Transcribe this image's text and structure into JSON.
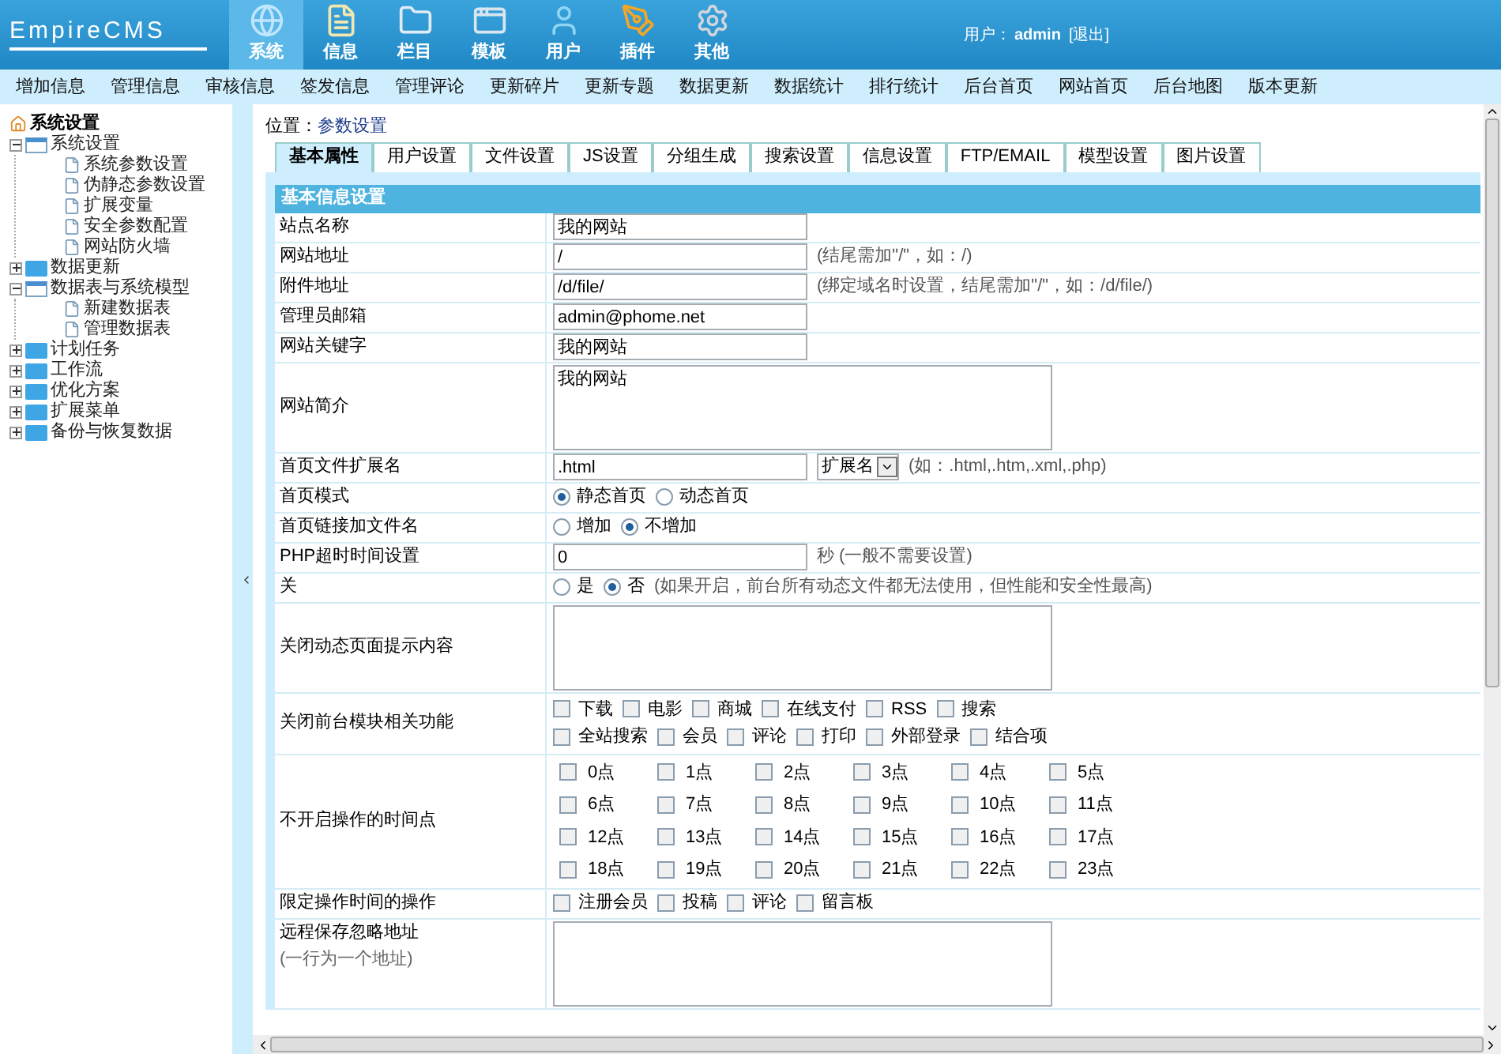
{
  "header": {
    "logo": "EmpireCMS",
    "nav": [
      {
        "label": "系统",
        "selected": true
      },
      {
        "label": "信息",
        "selected": false
      },
      {
        "label": "栏目",
        "selected": false
      },
      {
        "label": "模板",
        "selected": false
      },
      {
        "label": "用户",
        "selected": false
      },
      {
        "label": "插件",
        "selected": false
      },
      {
        "label": "其他",
        "selected": false
      }
    ],
    "user_label": "用户：",
    "user": "admin",
    "logout": "[退出]"
  },
  "menu": [
    "增加信息",
    "管理信息",
    "审核信息",
    "签发信息",
    "管理评论",
    "更新碎片",
    "更新专题",
    "数据更新",
    "数据统计",
    "排行统计",
    "后台首页",
    "网站首页",
    "后台地图",
    "版本更新"
  ],
  "tree": {
    "label": "系统设置",
    "children": [
      {
        "label": "系统设置",
        "expanded": true,
        "children": [
          {
            "label": "系统参数设置"
          },
          {
            "label": "伪静态参数设置"
          },
          {
            "label": "扩展变量"
          },
          {
            "label": "安全参数配置"
          },
          {
            "label": "网站防火墙"
          }
        ]
      },
      {
        "label": "数据更新",
        "expanded": false
      },
      {
        "label": "数据表与系统模型",
        "expanded": true,
        "children": [
          {
            "label": "新建数据表"
          },
          {
            "label": "管理数据表"
          }
        ]
      },
      {
        "label": "计划任务",
        "expanded": false
      },
      {
        "label": "工作流",
        "expanded": false
      },
      {
        "label": "优化方案",
        "expanded": false
      },
      {
        "label": "扩展菜单",
        "expanded": false
      },
      {
        "label": "备份与恢复数据",
        "expanded": false
      }
    ]
  },
  "breadcrumb": {
    "label": "位置：",
    "value": "参数设置"
  },
  "tabs": [
    {
      "label": "基本属性",
      "selected": true
    },
    {
      "label": "用户设置",
      "selected": false
    },
    {
      "label": "文件设置",
      "selected": false
    },
    {
      "label": "JS设置",
      "selected": false
    },
    {
      "label": "分组生成",
      "selected": false
    },
    {
      "label": "搜索设置",
      "selected": false
    },
    {
      "label": "信息设置",
      "selected": false
    },
    {
      "label": "FTP/EMAIL",
      "selected": false
    },
    {
      "label": "模型设置",
      "selected": false
    },
    {
      "label": "图片设置",
      "selected": false
    }
  ],
  "section_title": "基本信息设置",
  "rows": [
    {
      "kind": "text",
      "label": "站点名称",
      "value": "我的网站"
    },
    {
      "kind": "text",
      "label": "网站地址",
      "value": "/",
      "hint": "(结尾需加\"/\"，如：/)"
    },
    {
      "kind": "text",
      "label": "附件地址",
      "value": "/d/file/",
      "hint": "(绑定域名时设置，结尾需加\"/\"，如：/d/file/)"
    },
    {
      "kind": "text",
      "label": "管理员邮箱",
      "value": "admin@phome.net"
    },
    {
      "kind": "text",
      "label": "网站关键字",
      "value": "我的网站"
    },
    {
      "kind": "textarea",
      "label": "网站简介",
      "value": "我的网站"
    },
    {
      "kind": "text",
      "label": "首页文件扩展名",
      "value": ".html",
      "select": "扩展名",
      "hint": "(如：.html,.htm,.xml,.php)"
    },
    {
      "kind": "radio",
      "label": "首页模式",
      "options": [
        {
          "label": "静态首页",
          "selected": true
        },
        {
          "label": "动态首页",
          "selected": false
        }
      ]
    },
    {
      "kind": "radio",
      "label": "首页链接加文件名",
      "options": [
        {
          "label": "增加",
          "selected": false
        },
        {
          "label": "不增加",
          "selected": true
        }
      ]
    },
    {
      "kind": "text",
      "label": "PHP超时时间设置",
      "value": "0",
      "hint": "秒 (一般不需要设置)"
    },
    {
      "kind": "radio",
      "label": "关",
      "options": [
        {
          "label": "是",
          "selected": false
        },
        {
          "label": "否",
          "selected": true
        }
      ],
      "hint": "(如果开启，前台所有动态文件都无法使用，但性能和安全性最高)"
    },
    {
      "kind": "textarea",
      "label": "关闭动态页面提示内容"
    },
    {
      "kind": "checks",
      "label": "关闭前台模块相关功能",
      "options": [
        {
          "label": "下载",
          "checked": false
        },
        {
          "label": "电影",
          "checked": false
        },
        {
          "label": "商城",
          "checked": false
        },
        {
          "label": "在线支付",
          "checked": false
        },
        {
          "label": "RSS",
          "checked": false
        },
        {
          "label": "搜索",
          "checked": false
        },
        {
          "label": "全站搜索",
          "checked": false
        },
        {
          "label": "会员",
          "checked": false
        },
        {
          "label": "评论",
          "checked": false
        },
        {
          "label": "打印",
          "checked": false
        },
        {
          "label": "外部登录",
          "checked": false
        },
        {
          "label": "结合项",
          "checked": false
        }
      ]
    },
    {
      "kind": "grid",
      "label": "不开启操作的时间点",
      "options": [
        {
          "label": "0点",
          "checked": false
        },
        {
          "label": "1点",
          "checked": false
        },
        {
          "label": "2点",
          "checked": false
        },
        {
          "label": "3点",
          "checked": false
        },
        {
          "label": "4点",
          "checked": false
        },
        {
          "label": "5点",
          "checked": false
        },
        {
          "label": "6点",
          "checked": false
        },
        {
          "label": "7点",
          "checked": false
        },
        {
          "label": "8点",
          "checked": false
        },
        {
          "label": "9点",
          "checked": false
        },
        {
          "label": "10点",
          "checked": false
        },
        {
          "label": "11点",
          "checked": false
        },
        {
          "label": "12点",
          "checked": false
        },
        {
          "label": "13点",
          "checked": false
        },
        {
          "label": "14点",
          "checked": false
        },
        {
          "label": "15点",
          "checked": false
        },
        {
          "label": "16点",
          "checked": false
        },
        {
          "label": "17点",
          "checked": false
        },
        {
          "label": "18点",
          "checked": false
        },
        {
          "label": "19点",
          "checked": false
        },
        {
          "label": "20点",
          "checked": false
        },
        {
          "label": "21点",
          "checked": false
        },
        {
          "label": "22点",
          "checked": false
        },
        {
          "label": "23点",
          "checked": false
        }
      ]
    },
    {
      "kind": "checks",
      "label": "限定操作时间的操作",
      "options": [
        {
          "label": "注册会员",
          "checked": false
        },
        {
          "label": "投稿",
          "checked": false
        },
        {
          "label": "评论",
          "checked": false
        },
        {
          "label": "留言板",
          "checked": false
        }
      ]
    },
    {
      "kind": "textarea",
      "label": "远程保存忽略地址",
      "note": "(一行为一个地址)"
    }
  ]
}
